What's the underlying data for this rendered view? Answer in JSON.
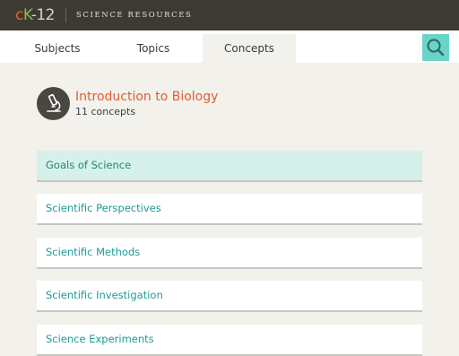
{
  "header": {
    "logo_c": "c",
    "logo_k": "K",
    "logo_num": "-12",
    "site_title": "Science Resources"
  },
  "nav": {
    "tabs": [
      {
        "label": "Subjects",
        "active": false
      },
      {
        "label": "Topics",
        "active": false
      },
      {
        "label": "Concepts",
        "active": true
      }
    ],
    "search_icon": "search-icon"
  },
  "subject": {
    "icon": "microscope-icon",
    "title": "Introduction to Biology",
    "count": "11 concepts"
  },
  "concepts": [
    {
      "label": "Goals of Science",
      "selected": true
    },
    {
      "label": "Scientific Perspectives",
      "selected": false
    },
    {
      "label": "Scientific Methods",
      "selected": false
    },
    {
      "label": "Scientific Investigation",
      "selected": false
    },
    {
      "label": "Science Experiments",
      "selected": false
    }
  ],
  "colors": {
    "topbar": "#3d3a33",
    "accent_teal": "#6bd4c8",
    "title_orange": "#e85c2c",
    "link_teal": "#1f9b94",
    "selected_row": "#d5f1ea"
  }
}
